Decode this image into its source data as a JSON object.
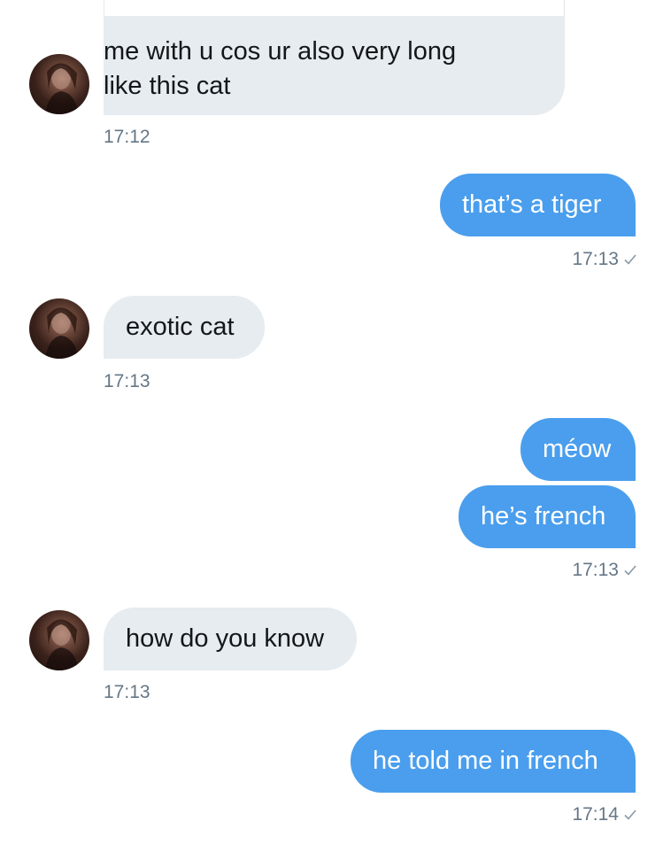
{
  "conversation": {
    "messages": [
      {
        "sender": "them",
        "lines": [
          "me with u cos ur also very long",
          "like this cat"
        ],
        "time": "17:12"
      },
      {
        "sender": "me",
        "text": "that’s a tiger",
        "time": "17:13"
      },
      {
        "sender": "them",
        "text": "exotic cat",
        "time": "17:13"
      },
      {
        "sender": "me",
        "text": "méow"
      },
      {
        "sender": "me",
        "text": "he’s french",
        "time": "17:13"
      },
      {
        "sender": "them",
        "text": "how do you know",
        "time": "17:13"
      },
      {
        "sender": "me",
        "text": "he told me in french",
        "time": "17:14"
      }
    ]
  },
  "colors": {
    "outgoing_bubble": "#4a9eed",
    "incoming_bubble": "#e6ecf0",
    "timestamp": "#657786"
  },
  "icons": {
    "read_receipt": "check-icon",
    "avatar": "avatar"
  }
}
